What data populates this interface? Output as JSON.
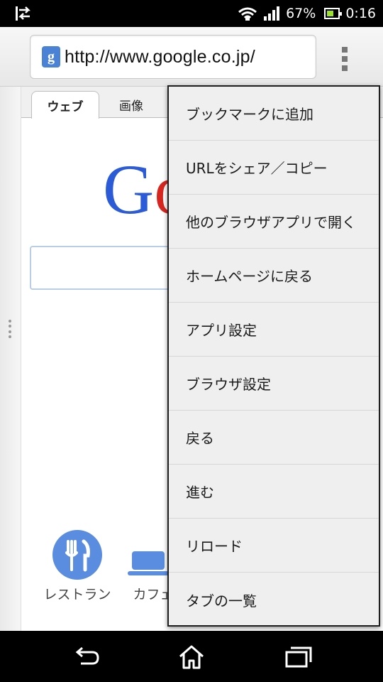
{
  "status_bar": {
    "battery_percent": "67%",
    "time": "0:16",
    "battery_level": 0.67,
    "icons": [
      "data-sync-icon",
      "wifi-icon",
      "signal-icon",
      "battery-icon"
    ]
  },
  "browser": {
    "url": "http://www.google.co.jp/",
    "favicon_letter": "g",
    "tabs": [
      "ウェブ",
      "画像"
    ]
  },
  "page": {
    "logo_letters": [
      "G",
      "o"
    ],
    "shortcuts": [
      {
        "label": "レストラン",
        "icon": "restaurant-icon"
      },
      {
        "label": "カフェ",
        "icon": "cafe-icon"
      }
    ]
  },
  "menu": {
    "items": [
      "ブックマークに追加",
      "URLをシェア／コピー",
      "他のブラウザアプリで開く",
      "ホームページに戻る",
      "アプリ設定",
      "ブラウザ設定",
      "戻る",
      "進む",
      "リロード",
      "タブの一覧"
    ]
  },
  "colors": {
    "logo_blue": "#2b5bd6",
    "logo_red": "#d6261f",
    "icon_blue": "#5a8de0",
    "battery_green": "#9be22d"
  }
}
